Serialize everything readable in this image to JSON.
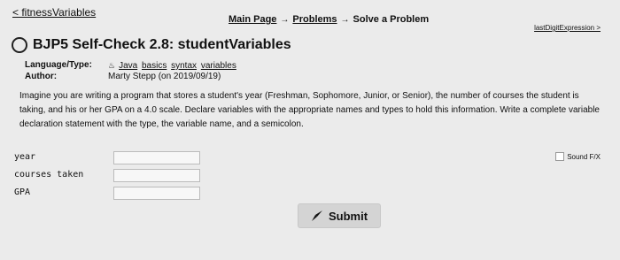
{
  "nav": {
    "prev": "< fitnessVariables",
    "crumbs": [
      "Main Page",
      "Problems",
      "Solve a Problem"
    ],
    "separator": "→",
    "next": "lastDigitExpression >"
  },
  "header": {
    "title": "BJP5 Self-Check 2.8: studentVariables"
  },
  "meta": {
    "language_label": "Language/Type:",
    "language_links": [
      "Java",
      "basics",
      "syntax",
      "variables"
    ],
    "author_label": "Author:",
    "author_value": "Marty Stepp (on 2019/09/19)"
  },
  "prompt": {
    "text": "Imagine you are writing a program that stores a student's year (Freshman, Sophomore, Junior, or Senior), the number of courses the student is taking, and his or her GPA on a 4.0 scale. Declare variables with the appropriate names and types to hold this information. Write a complete variable declaration statement with the type, the variable name, and a semicolon."
  },
  "form": {
    "rows": [
      {
        "label": "year",
        "value": ""
      },
      {
        "label": "courses taken",
        "value": ""
      },
      {
        "label": "GPA",
        "value": ""
      }
    ]
  },
  "sound": {
    "label": "Sound F/X",
    "checked": false
  },
  "submit": {
    "label": "Submit",
    "icon": "pen-nib-icon"
  }
}
